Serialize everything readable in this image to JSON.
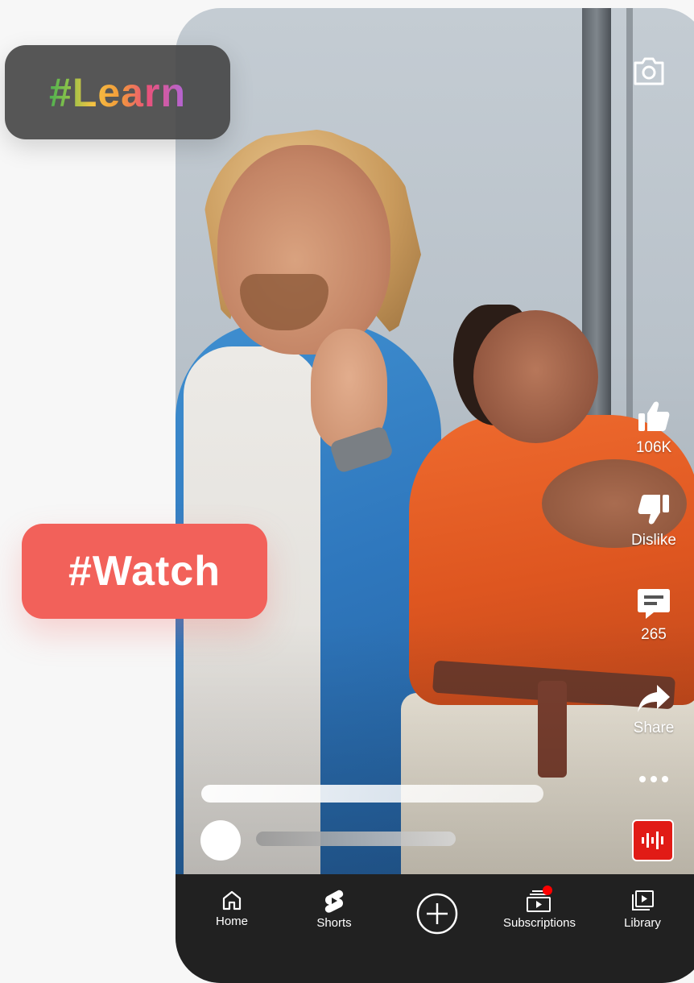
{
  "tags": {
    "learn": "#Learn",
    "watch": "#Watch"
  },
  "actions": {
    "like_count": "106K",
    "dislike_label": "Dislike",
    "comment_count": "265",
    "share_label": "Share"
  },
  "nav": {
    "home": "Home",
    "shorts": "Shorts",
    "subscriptions": "Subscriptions",
    "library": "Library"
  },
  "icons": {
    "top_right": "camera-icon",
    "like": "thumbs-up-icon",
    "dislike": "thumbs-down-icon",
    "comment": "comment-icon",
    "share": "share-arrow-icon",
    "more": "more-dots-icon",
    "sound": "audio-waveform-icon",
    "create": "plus-circle-icon"
  },
  "colors": {
    "brand_red": "#e11b16",
    "watch_tag": "#f2615a",
    "nav_bg": "#212121"
  }
}
